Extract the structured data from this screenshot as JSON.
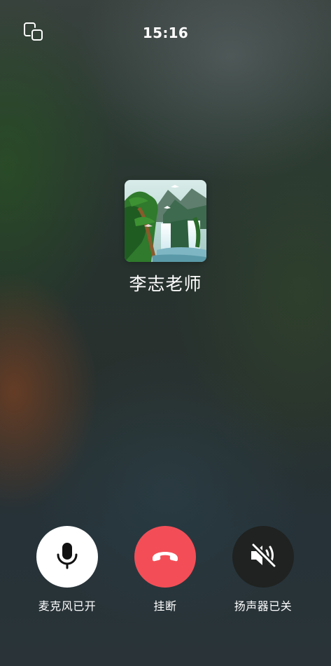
{
  "status_bar": {
    "time": "15:16",
    "window_icon": "minimize-window-icon"
  },
  "caller": {
    "name": "李志老师",
    "avatar": "landscape-waterfall-avatar"
  },
  "controls": [
    {
      "label": "麦克风已开",
      "icon": "microphone-icon",
      "state": "on",
      "color": "#ffffff"
    },
    {
      "label": "挂断",
      "icon": "hang-up-icon",
      "color": "#f34e57"
    },
    {
      "label": "扬声器已关",
      "icon": "speaker-muted-icon",
      "state": "off",
      "color": "#1f2220"
    }
  ]
}
